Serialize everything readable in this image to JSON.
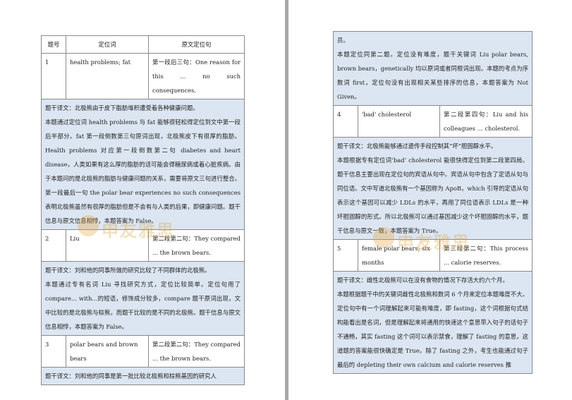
{
  "watermark": "申友雅思",
  "left_page": {
    "table": {
      "headers": [
        "题号",
        "定位词",
        "原文定位句"
      ],
      "rows": [
        {
          "num": "1",
          "keywords": "health problems; fat",
          "source": "第一段后三句：One reason for this ... no such consequences."
        },
        {
          "num": "2",
          "keywords": "Liu",
          "source": "第二段第二句：They compared ... the brown bears."
        },
        {
          "num": "3",
          "keywords": "polar bears and brown bears",
          "source": "第二段第二句：They compared ... the brown bears."
        }
      ],
      "notes": [
        [
          "题干译文：北极熊由于皮下脂肪堆积遭受着各种健康问题。",
          "本题通过定位词 health problems 与 fat 能够很轻松得定位到文中第一段后半部分。fat 第一段倒数第三句原词出现，北极熊皮下有很厚的脂肪。Health problems 对应第一段倒数第二句 diabetes and heart disease，人类如果有这么厚的脂肪的话可能会得糖尿病或着心脏疾病。由于本题问的是北极熊的脂肪与健康问题的关系，需要将原文三句进行整合。第一段最后一句 the polar bear experiences no such consequences 表明北极熊虽然有很厚的脂肪但是不会有与人类的后果，即健康问题。题干信息与原文信息相悖，本题答案为 False。"
        ],
        [
          "题干译文：刘和他的同事所做的研究比较了不同群体的北极熊。",
          "本题通过专有名词 Liu 寻找研究方式，定位比较简单。定位句用了 compare... with...的短语，修饰成分较多，compare 题干原词出现，文中比较的是北极熊与棕熊，而题干比较的是不同的北极熊。题干信息与原文信息相悖，本题答案为 False。"
        ],
        [
          "题干译文：刘和他的同事是第一批比较北极熊和棕熊基因的研究人"
        ]
      ]
    }
  },
  "right_page": {
    "intro": [
      "员。",
      "本题定位同第二题。定位没有难度，题干关键词 Liu polar bears, brown bears，genetically 均以原词或者同根词出现。本题的考点为序数词 first，定位句没有出现相关某些排序的信息，本题答案为 Not Given。"
    ],
    "table": {
      "rows": [
        {
          "num": "4",
          "keywords": "'bad' cholesterol",
          "source": "第二段第四句：Liu and his colleagues ... cholesterol."
        },
        {
          "num": "5",
          "keywords": "female polar bears; six months",
          "source": "第三段第二句：This process ... calorie reserves."
        }
      ],
      "notes": [
        [
          "题干译文：北极熊能够通过遗传手段控制其“坏”胆固醇水平。",
          "本题根据专有定位词‘bad’ cholesterol 能很快得定位到第二段第四局。题干信息主要出现在定位句的宾语从句中。宾语从句中包含了定语从句与同位语。文中写道北极熊有一个基因称为 ApoB，which 引导的定语从句表示这个基因可以减少 LDLs 的水平，再用了同位语表示 LDLs 是一种坏胆固醇的形式。所以北极熊可以通过基因减少这个坏胆固醇的水平，题干信息与原文一致，本题答案为 True。"
        ],
        [
          "题干译文：雌性北极熊可以在没有食物的情况下存活大约六个月。",
          "本题根据题干中的关键词雌性北极熊和数词 6 个月来定位本题难度不大。定位句中有一个词理解起来可能有难度，即 fasting，这个词根据句式结构能看出是名词，但是理解起来将通用的快速这个意思带入句子的话句子不通畅，其实 fasting 这个词可以表示禁食，理解了 fasting 的意思，这道题的答案能很快确定是 True。除了 fasting 之外，考生也能通过句子最后的 depleting their own calcium and calorie reserves 推"
        ]
      ]
    }
  }
}
